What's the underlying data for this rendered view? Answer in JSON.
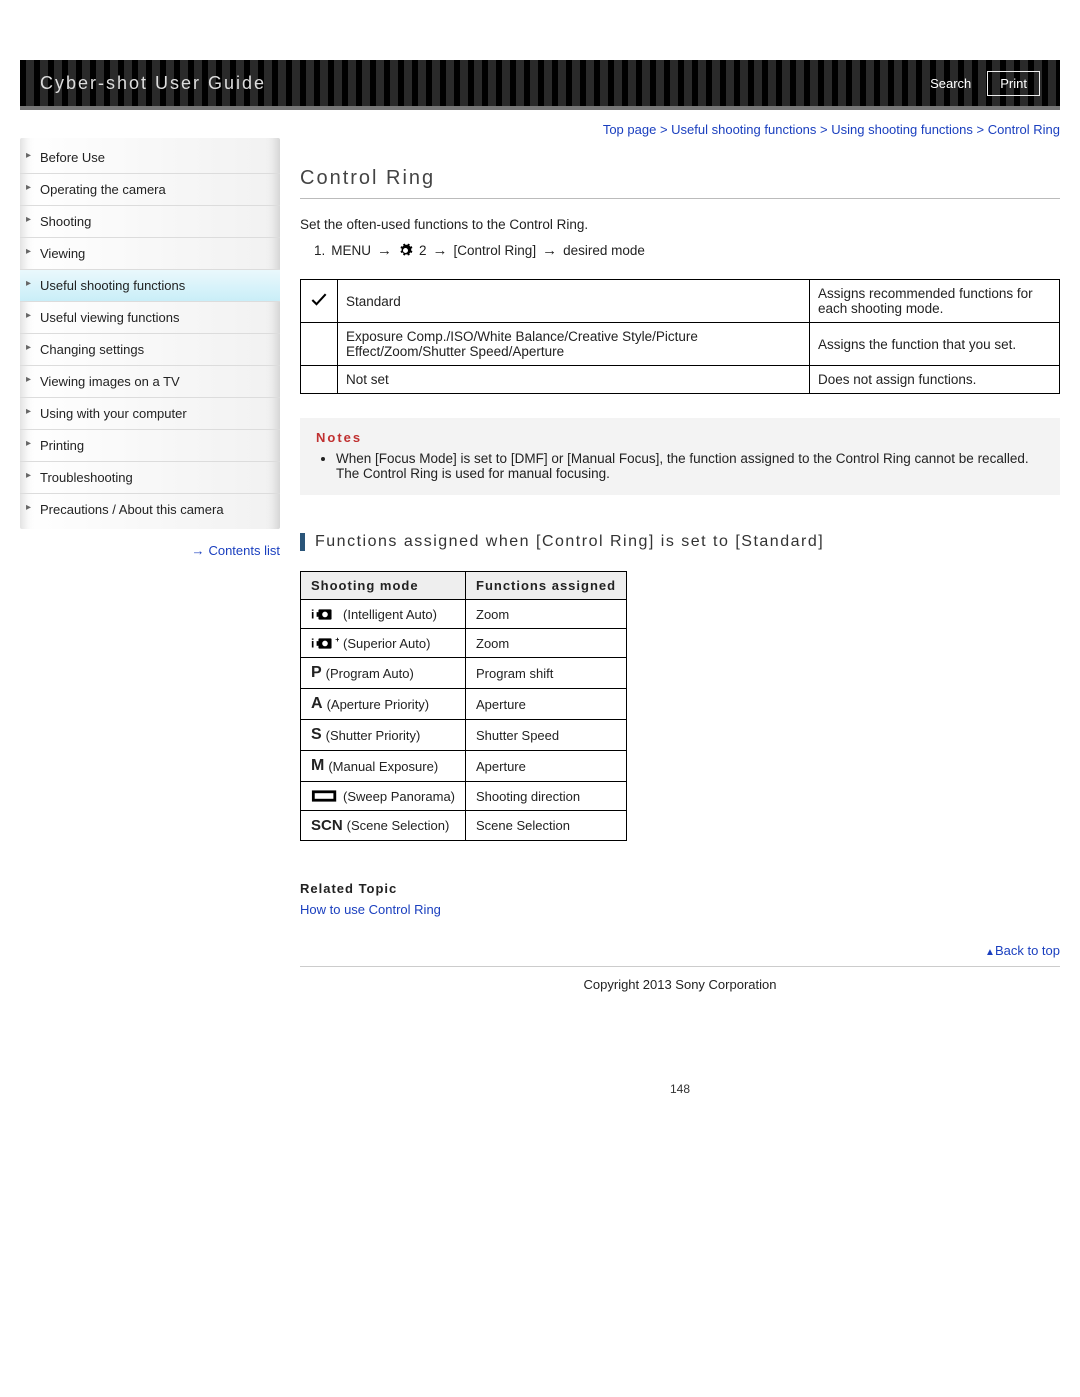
{
  "header": {
    "title": "Cyber-shot User Guide",
    "search": "Search",
    "print": "Print"
  },
  "sidebar": {
    "items": [
      "Before Use",
      "Operating the camera",
      "Shooting",
      "Viewing",
      "Useful shooting functions",
      "Useful viewing functions",
      "Changing settings",
      "Viewing images on a TV",
      "Using with your computer",
      "Printing",
      "Troubleshooting",
      "Precautions / About this camera"
    ],
    "active_index": 4,
    "contents_list": "Contents list"
  },
  "breadcrumb": {
    "parts": [
      "Top page",
      "Useful shooting functions",
      "Using shooting functions",
      "Control Ring"
    ],
    "sep": " > "
  },
  "page_title": "Control Ring",
  "intro": "Set the often-used functions to the Control Ring.",
  "step": {
    "num": "1.",
    "menu": "MENU",
    "two": "2",
    "bracket": "[Control Ring]",
    "tail": "desired mode"
  },
  "options_table": [
    {
      "checked": true,
      "label": "Standard",
      "desc": "Assigns recommended functions for each shooting mode."
    },
    {
      "checked": false,
      "label": "Exposure Comp./ISO/White Balance/Creative Style/Picture Effect/Zoom/Shutter Speed/Aperture",
      "desc": "Assigns the function that you set."
    },
    {
      "checked": false,
      "label": "Not set",
      "desc": "Does not assign functions."
    }
  ],
  "notes": {
    "title": "Notes",
    "items": [
      "When [Focus Mode] is set to [DMF] or [Manual Focus], the function assigned to the Control Ring cannot be recalled. The Control Ring is used for manual focusing."
    ]
  },
  "sub_title": "Functions assigned when [Control Ring] is set to [Standard]",
  "modes_table": {
    "headers": [
      "Shooting mode",
      "Functions assigned"
    ],
    "rows": [
      {
        "icon": "iauto",
        "label": "(Intelligent Auto)",
        "fn": "Zoom"
      },
      {
        "icon": "iautoplus",
        "label": "(Superior Auto)",
        "fn": "Zoom"
      },
      {
        "icon": "P",
        "label": "(Program Auto)",
        "fn": "Program shift"
      },
      {
        "icon": "A",
        "label": "(Aperture Priority)",
        "fn": "Aperture"
      },
      {
        "icon": "S",
        "label": "(Shutter Priority)",
        "fn": "Shutter Speed"
      },
      {
        "icon": "M",
        "label": "(Manual Exposure)",
        "fn": "Aperture"
      },
      {
        "icon": "panorama",
        "label": "(Sweep Panorama)",
        "fn": "Shooting direction"
      },
      {
        "icon": "SCN",
        "label": "(Scene Selection)",
        "fn": "Scene Selection"
      }
    ]
  },
  "related": {
    "title": "Related Topic",
    "link": "How to use Control Ring"
  },
  "back_top": "Back to top",
  "copyright": "Copyright 2013 Sony Corporation",
  "page_number": "148"
}
